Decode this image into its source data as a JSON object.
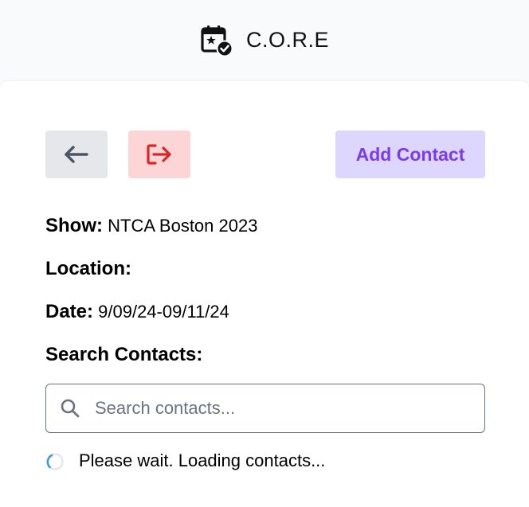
{
  "app": {
    "title": "C.O.R.E",
    "logo_icon": "calendar-star-check-icon"
  },
  "toolbar": {
    "back_icon": "arrow-left-icon",
    "logout_icon": "logout-icon",
    "add_contact_label": "Add Contact"
  },
  "show_info": {
    "show_label": "Show:",
    "show_value": "NTCA Boston 2023",
    "location_label": "Location:",
    "location_value": "",
    "date_label": "Date:",
    "date_value": "9/09/24-09/11/24"
  },
  "search": {
    "label": "Search Contacts:",
    "placeholder": "Search contacts...",
    "value": ""
  },
  "status": {
    "loading_text": "Please wait. Loading contacts..."
  },
  "colors": {
    "accent": "#7c3aed",
    "add_button_bg": "#ddd6fe",
    "logout_bg": "#fcd5d6",
    "logout_icon": "#dc2626",
    "back_bg": "#e5e7eb",
    "spinner": "#3b9dd8"
  }
}
